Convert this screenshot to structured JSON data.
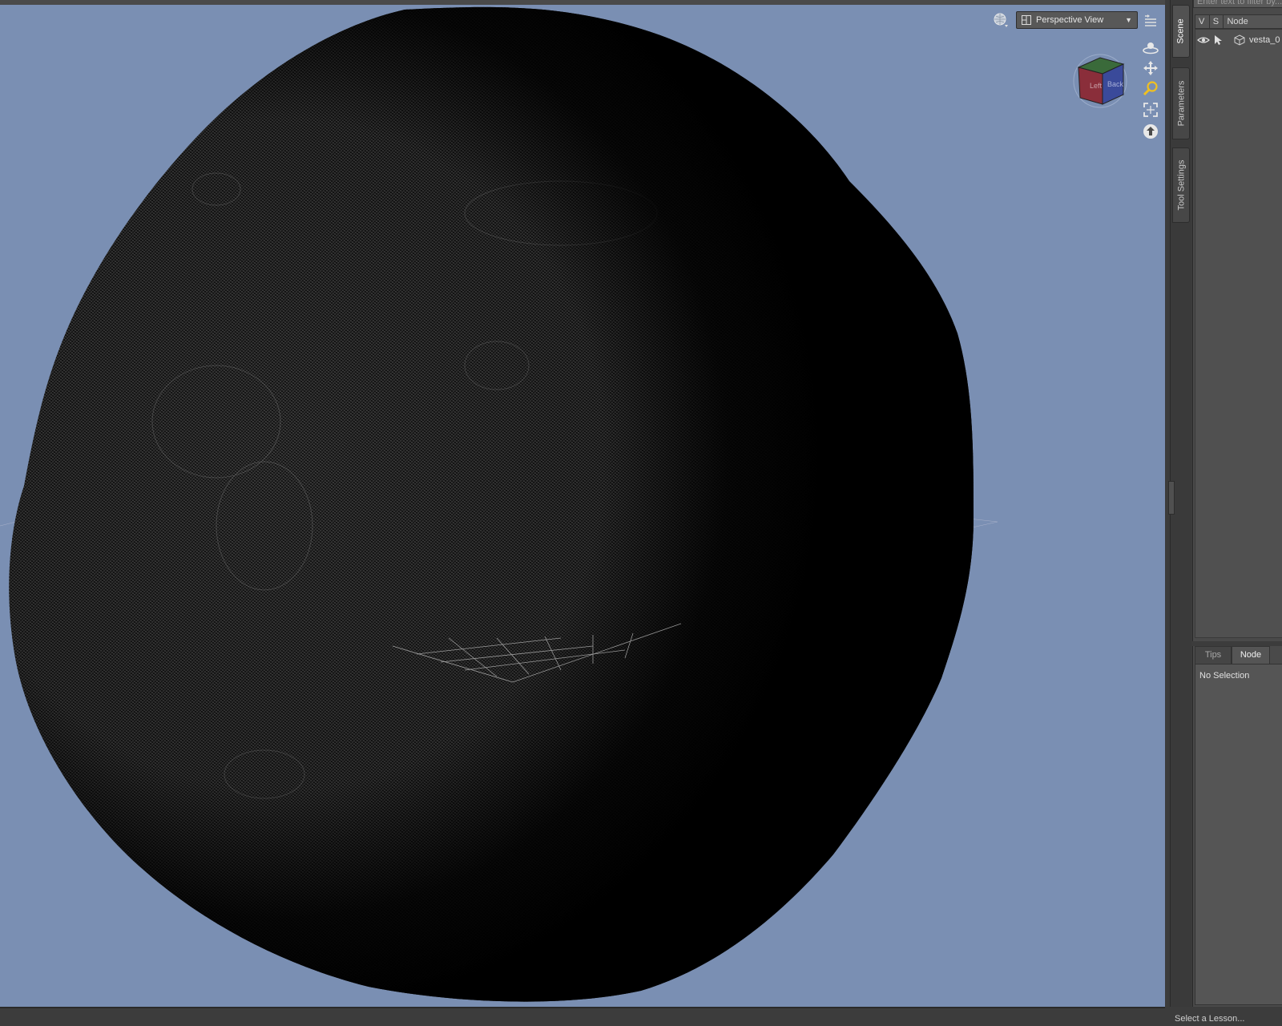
{
  "viewport": {
    "view_select": {
      "label": "Perspective View",
      "icon": "view-layout-icon",
      "arrow": "▼"
    },
    "background_color": "#7a8fb3",
    "nav_tools": [
      "orbit-icon",
      "pan-icon",
      "zoom-icon",
      "frame-icon",
      "reset-view-icon"
    ],
    "view_cube": {
      "left_face": "Left",
      "right_face": "Back"
    }
  },
  "side_tabs": [
    {
      "label": "Scene",
      "active": true
    },
    {
      "label": "Parameters",
      "active": false
    },
    {
      "label": "Tool Settings",
      "active": false
    }
  ],
  "scene": {
    "filter_placeholder": "Enter text to filter by...",
    "columns": {
      "visible": "V",
      "selectable": "S",
      "node": "Node"
    },
    "nodes": [
      {
        "name": "vesta_0"
      }
    ]
  },
  "info_pane": {
    "tabs": [
      {
        "label": "Tips",
        "active": false
      },
      {
        "label": "Node",
        "active": true
      }
    ],
    "body": "No Selection"
  },
  "status_bar": {
    "text": "Select a Lesson..."
  }
}
